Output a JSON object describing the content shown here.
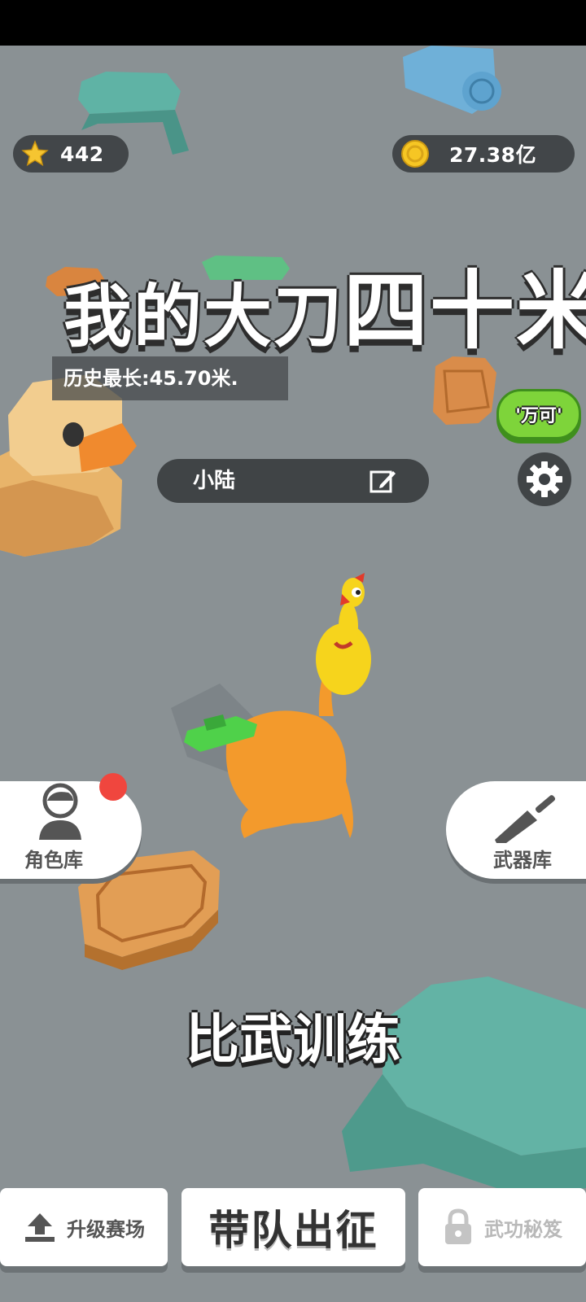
{
  "hud": {
    "stars": "442",
    "coins": "27.38亿"
  },
  "banner": {
    "title_part1": "我的大刀",
    "title_part2": "四十米",
    "history_record": "历史最长:45.70米."
  },
  "player": {
    "name": "小陆"
  },
  "side_buttons": {
    "wanke_label": "'万可'",
    "character_library": "角色库",
    "weapon_library": "武器库"
  },
  "mode_label": "比武训练",
  "bottom_nav": {
    "upgrade_arena": "升级赛场",
    "lead_team": "带队出征",
    "martial_secret": "武功秘笈"
  },
  "colors": {
    "background": "#8a9194",
    "hud_pill": "#323638",
    "green_button": "#7ed43a",
    "notification_dot": "#f0463e",
    "white_card": "#ffffff"
  },
  "icons": {
    "star": "star-icon",
    "coin": "coin-icon",
    "edit": "edit-icon",
    "settings": "gear-icon",
    "character": "person-icon",
    "weapon": "knife-icon",
    "upload": "upload-icon",
    "lock": "lock-icon"
  }
}
